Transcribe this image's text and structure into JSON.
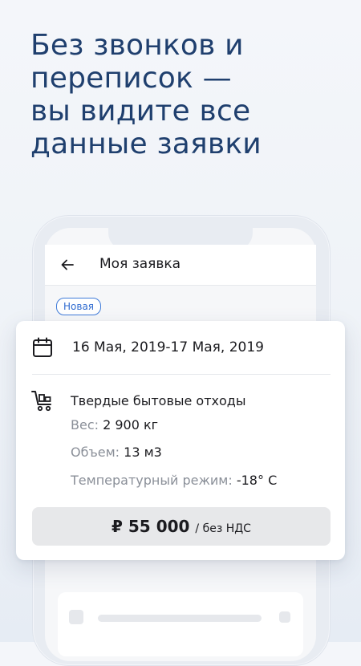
{
  "headline": [
    "Без звонков и",
    "переписок —",
    "вы видите все",
    "данные заявки"
  ],
  "appbar": {
    "title": "Моя заявка"
  },
  "status": {
    "label": "Новая"
  },
  "order": {
    "date_range": "16 Мая, 2019-17 Мая, 2019",
    "cargo_type": "Твердые бытовые отходы",
    "details": [
      {
        "label": "Вес:",
        "value": "2 900 кг"
      },
      {
        "label": "Объем:",
        "value": "13 м3"
      },
      {
        "label": "Температурный режим:",
        "value": "-18° С"
      }
    ],
    "price": {
      "amount": "₽ 55 000",
      "suffix": "/ без НДС"
    }
  },
  "icons": {
    "back": "arrow-left-icon",
    "calendar": "calendar-icon",
    "cart": "cart-icon"
  },
  "colors": {
    "accent": "#1f3f6e",
    "badge": "#2f6bd0"
  }
}
